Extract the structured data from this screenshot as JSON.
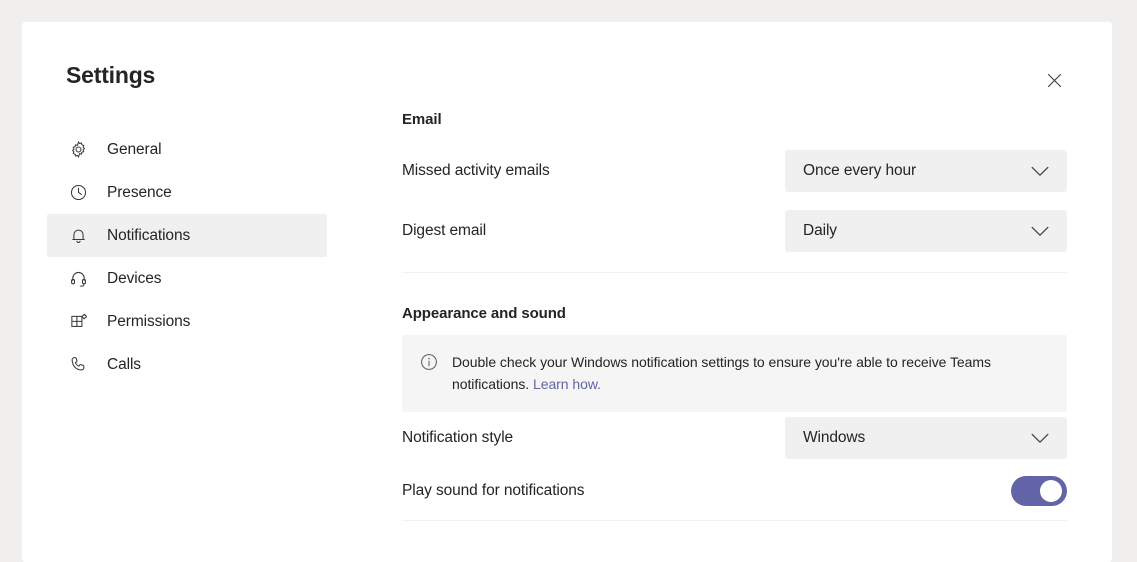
{
  "window": {
    "title": "Settings",
    "close_icon": "close-icon"
  },
  "sidebar": {
    "items": [
      {
        "label": "General",
        "icon": "gear-icon",
        "selected": false
      },
      {
        "label": "Presence",
        "icon": "clock-icon",
        "selected": false
      },
      {
        "label": "Notifications",
        "icon": "bell-icon",
        "selected": true
      },
      {
        "label": "Devices",
        "icon": "headset-icon",
        "selected": false
      },
      {
        "label": "Permissions",
        "icon": "app-grid-icon",
        "selected": false
      },
      {
        "label": "Calls",
        "icon": "phone-icon",
        "selected": false
      }
    ]
  },
  "main": {
    "sections": [
      {
        "heading": "Email",
        "rows": [
          {
            "label": "Missed activity emails",
            "control": "dropdown",
            "value": "Once every hour"
          },
          {
            "label": "Digest email",
            "control": "dropdown",
            "value": "Daily"
          }
        ]
      },
      {
        "heading": "Appearance and sound",
        "banner": {
          "icon": "info-icon",
          "text": "Double check your Windows notification settings to ensure you're able to receive Teams notifications.",
          "link_text": "Learn how."
        },
        "rows": [
          {
            "label": "Notification style",
            "control": "dropdown",
            "value": "Windows"
          },
          {
            "label": "Play sound for notifications",
            "control": "toggle",
            "value": "on"
          }
        ]
      }
    ]
  },
  "colors": {
    "accent": "#6264a7",
    "dialog_background": "#ffffff",
    "page_background": "#f0efee",
    "control_background": "#f0f0f0",
    "banner_background": "#f5f5f5",
    "selected_nav_background": "#f0f0f0",
    "text_primary": "#252423",
    "divider": "#f3f2f1"
  }
}
